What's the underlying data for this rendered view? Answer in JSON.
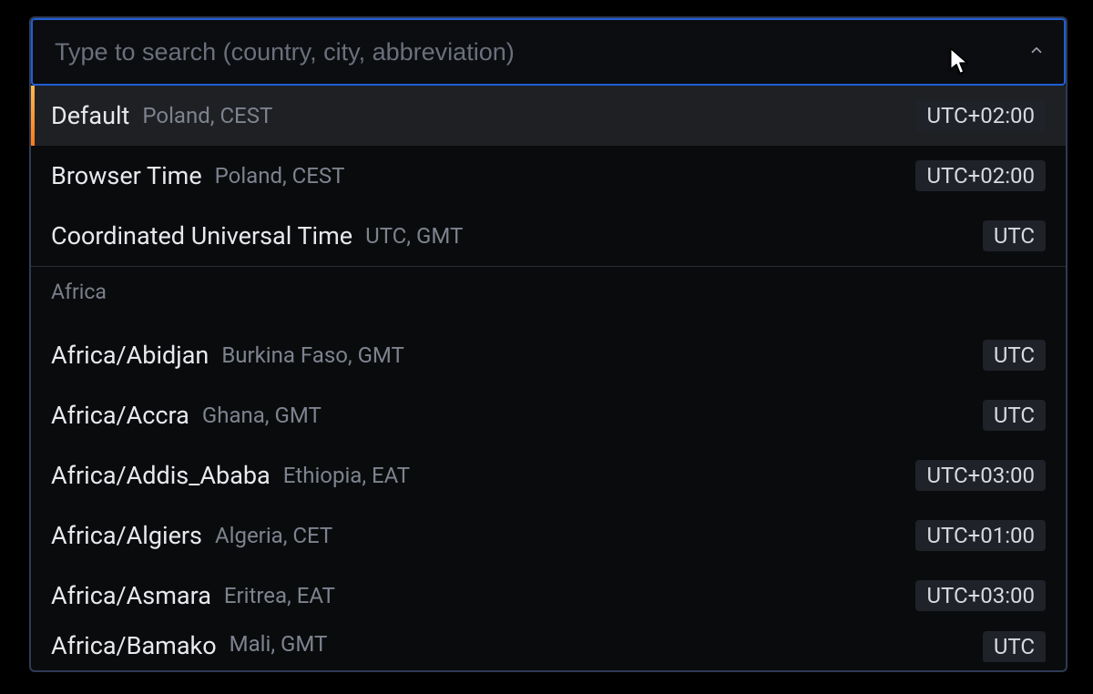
{
  "search": {
    "placeholder": "Type to search (country, city, abbreviation)",
    "value": ""
  },
  "top_options": [
    {
      "name": "Default",
      "sub": "Poland, CEST",
      "badge": "UTC+02:00",
      "selected": true
    },
    {
      "name": "Browser Time",
      "sub": "Poland, CEST",
      "badge": "UTC+02:00",
      "selected": false
    },
    {
      "name": "Coordinated Universal Time",
      "sub": "UTC, GMT",
      "badge": "UTC",
      "selected": false
    }
  ],
  "group_label": "Africa",
  "group_options": [
    {
      "name": "Africa/Abidjan",
      "sub": "Burkina Faso, GMT",
      "badge": "UTC"
    },
    {
      "name": "Africa/Accra",
      "sub": "Ghana, GMT",
      "badge": "UTC"
    },
    {
      "name": "Africa/Addis_Ababa",
      "sub": "Ethiopia, EAT",
      "badge": "UTC+03:00"
    },
    {
      "name": "Africa/Algiers",
      "sub": "Algeria, CET",
      "badge": "UTC+01:00"
    },
    {
      "name": "Africa/Asmara",
      "sub": "Eritrea, EAT",
      "badge": "UTC+03:00"
    },
    {
      "name": "Africa/Bamako",
      "sub": "Mali, GMT",
      "badge": "UTC"
    }
  ]
}
